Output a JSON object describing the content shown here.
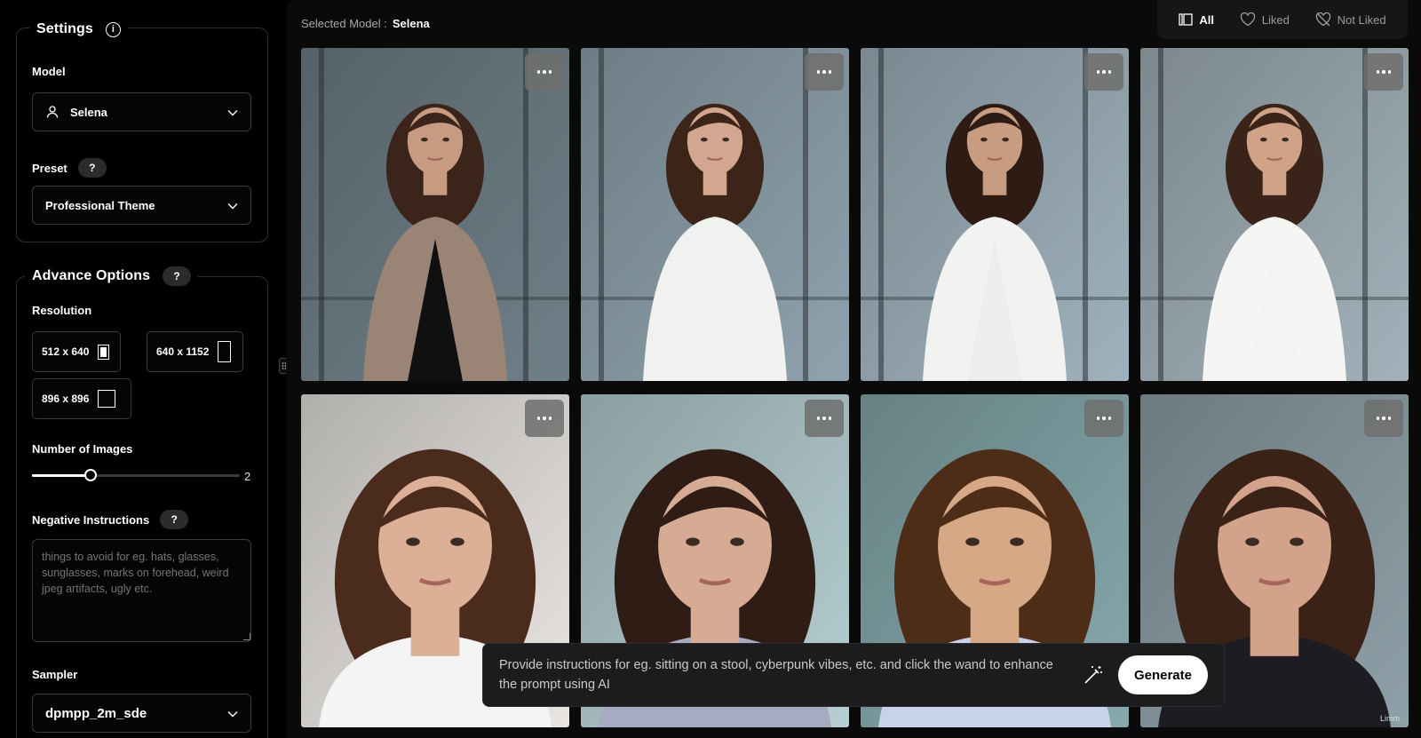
{
  "sidebar": {
    "settings_title": "Settings",
    "model_label": "Model",
    "model_value": "Selena",
    "preset_label": "Preset",
    "preset_help": "?",
    "preset_value": "Professional Theme",
    "advance_title": "Advance Options",
    "advance_help": "?",
    "resolution_label": "Resolution",
    "resolutions": [
      "512 x 640",
      "640 x 1152",
      "896 x 896"
    ],
    "num_images_label": "Number of Images",
    "num_images_value": "2",
    "num_images_fraction": 0.28,
    "negative_label": "Negative Instructions",
    "negative_help": "?",
    "negative_placeholder": "things to avoid for eg. hats, glasses, sunglasses, marks on forehead, weird jpeg artifacts, ugly etc.",
    "sampler_label": "Sampler",
    "sampler_value": "dpmpp_2m_sde"
  },
  "header": {
    "selected_model_label": "Selected Model :",
    "selected_model_value": "Selena"
  },
  "filters": {
    "all": "All",
    "liked": "Liked",
    "not_liked": "Not Liked"
  },
  "gallery": {
    "images": [
      {
        "bg": "#6f7f88",
        "outfit": "#101010",
        "jacket": "#9a8476",
        "hair": "#3b2419",
        "skin": "#c79b82"
      },
      {
        "bg": "#8fa3ae",
        "outfit": "#f1f1ef",
        "jacket": "#f1f1ef",
        "hair": "#3c2418",
        "skin": "#d3a78f"
      },
      {
        "bg": "#9fb2bd",
        "outfit": "#ededeb",
        "jacket": "#f2f2f0",
        "hair": "#2e1c14",
        "skin": "#c89c80"
      },
      {
        "bg": "#a2b1ba",
        "outfit": "#f3f3f1",
        "jacket": "#f5f5f3",
        "hair": "#3a2419",
        "skin": "#d0a288"
      },
      {
        "bg": "#e9e6e2",
        "outfit": "#f4f4f4",
        "jacket": "#f4f4f4",
        "hair": "#4a2b1c",
        "skin": "#dcaf97"
      },
      {
        "bg": "#b6cfd2",
        "outfit": "#a7abc2",
        "jacket": "#a7abc2",
        "hair": "#2f1c14",
        "skin": "#d6ab93"
      },
      {
        "bg": "#86a9ad",
        "outfit": "#c8d2e8",
        "jacket": "#c8d2e8",
        "hair": "#4d2c18",
        "skin": "#d7a886"
      },
      {
        "bg": "#8ea0a8",
        "outfit": "#1c1c22",
        "jacket": "#1c1c22",
        "hair": "#3a2216",
        "skin": "#d2a38a"
      }
    ]
  },
  "prompt": {
    "placeholder": "Provide instructions for eg. sitting on a stool, cyberpunk vibes, etc. and click the wand to enhance the prompt using AI",
    "generate_label": "Generate"
  },
  "watermark": "Limm"
}
